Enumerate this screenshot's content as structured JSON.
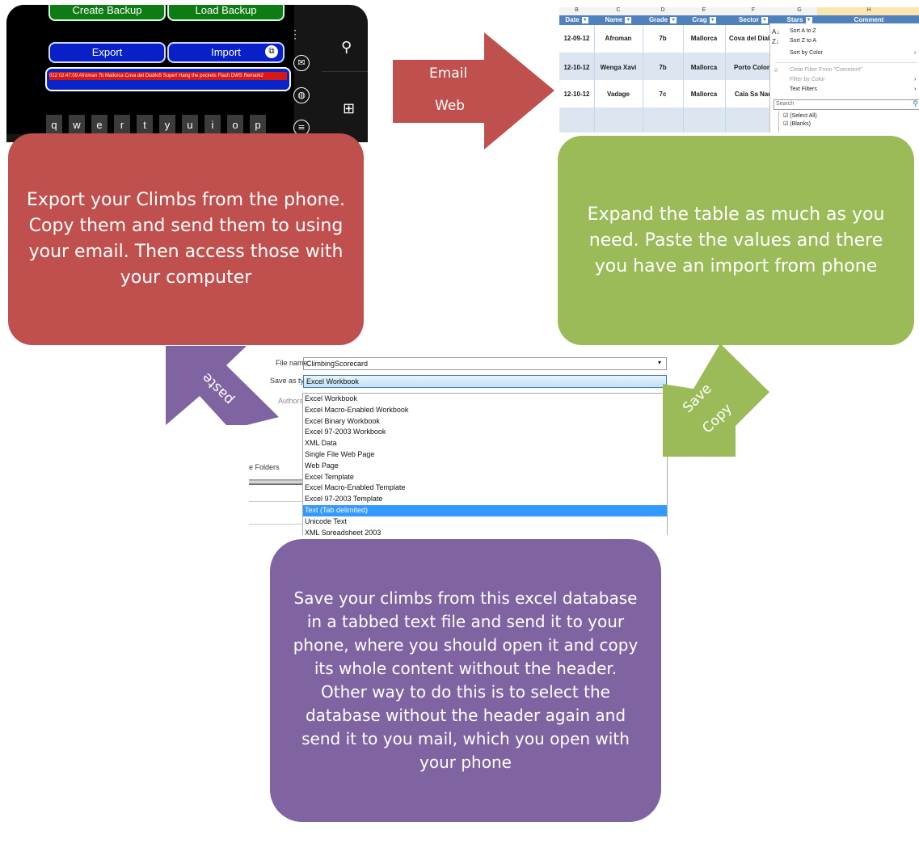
{
  "colors": {
    "red": "#c0504d",
    "green": "#9bbb59",
    "purple": "#8064a2"
  },
  "phone": {
    "buttons": {
      "create_backup": "Create Backup",
      "load_backup": "Load Backup",
      "export": "Export",
      "import": "Import"
    },
    "export_text": "012 02:47:09 Afroman 7b   Mallorca Cova del Diablo5  Super! Hang the pockets Flash   DWS   Remark2",
    "keys": [
      "q",
      "w",
      "e",
      "r",
      "t",
      "y",
      "u",
      "i",
      "o",
      "p"
    ],
    "icons": [
      "search-icon",
      "email-icon",
      "globe-icon",
      "list-icon",
      "windows-icon"
    ]
  },
  "boxes": {
    "red_text": "Export your Climbs from the phone. Copy them and send them to using your email. Then access those with your computer",
    "green_text": "Expand the table as much as you need. Paste the values and there you have an import from phone",
    "purple_text": "Save your climbs from this excel database in a tabbed text file and send it to your phone, where you should open it and copy its whole content without the header. Other way to do this is to select the database without the header again and send it to you mail, which you open with your phone"
  },
  "arrows": {
    "red": [
      "Email",
      "Web"
    ],
    "green": [
      "Save",
      "Copy"
    ],
    "purple": "paste"
  },
  "excel": {
    "col_letters": [
      "B",
      "C",
      "D",
      "E",
      "F",
      "G",
      "H"
    ],
    "headers": [
      "Date",
      "Name",
      "Grade",
      "Crag",
      "Sector",
      "Stars",
      "Comment"
    ],
    "rows": [
      [
        "12-09-12",
        "Afroman",
        "7b",
        "Mallorca",
        "Cova del Diablo"
      ],
      [
        "12-10-12",
        "Wenga Xavi",
        "7b",
        "Mallorca",
        "Porto Colom"
      ],
      [
        "12-10-12",
        "Vadage",
        "7c",
        "Mallorca",
        "Cala Sa Nau"
      ]
    ],
    "menu": {
      "sort_az": "Sort A to Z",
      "sort_za": "Sort Z to A",
      "sort_color": "Sort by Color",
      "clear_filter": "Clear Filter From \"Comment\"",
      "filter_color": "Filter by Color",
      "text_filters": "Text Filters",
      "search_placeholder": "Search",
      "select_all": "(Select All)",
      "blanks": "(Blanks)"
    }
  },
  "dialog": {
    "file_name_label": "File name:",
    "file_name_value": "ClimbingScorecard",
    "save_type_label": "Save as type:",
    "save_type_value": "Excel Workbook",
    "authors_label": "Authors:",
    "folders_label": "e Folders",
    "options": [
      "Excel Workbook",
      "Excel Macro-Enabled Workbook",
      "Excel Binary Workbook",
      "Excel 97-2003 Workbook",
      "XML Data",
      "Single File Web Page",
      "Web Page",
      "Excel Template",
      "Excel Macro-Enabled Template",
      "Excel 97-2003 Template",
      "Text (Tab delimited)",
      "Unicode Text",
      "XML Spreadsheet 2003"
    ],
    "selected_option": "Text (Tab delimited)"
  }
}
